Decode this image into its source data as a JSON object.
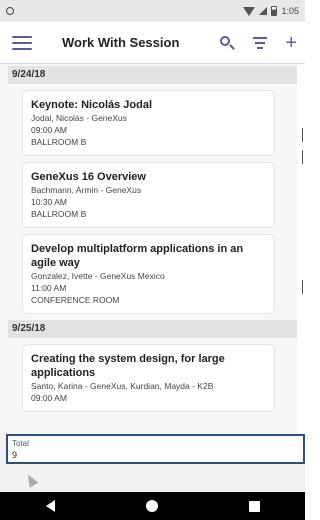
{
  "status_bar": {
    "time": "1:05"
  },
  "app_bar": {
    "title": "Work With Session"
  },
  "sessions": {
    "day1": {
      "date": "9/24/18",
      "items": [
        {
          "title": "Keynote: Nicolás Jodal",
          "speaker": "Jodal, Nicolás - GeneXus",
          "time": "09:00 AM",
          "room": "BALLROOM B"
        },
        {
          "title": "GeneXus 16 Overview",
          "speaker": "Bachmann, Armin - GeneXus",
          "time": "10:30 AM",
          "room": "BALLROOM B"
        },
        {
          "title": "Develop multiplatform applications in an agile way",
          "speaker": "Gonzalez, Ivette - GeneXus Mexico",
          "time": "11:00 AM",
          "room": "CONFERENCE ROOM"
        }
      ]
    },
    "day2": {
      "date": "9/25/18",
      "items": [
        {
          "title": "Creating the system design, for large applications",
          "speaker": "Santo, Karina - GeneXus, Kurdian, Mayda - K2B",
          "time": "09:00 AM"
        }
      ]
    }
  },
  "total": {
    "label": "Total",
    "value": "9"
  }
}
